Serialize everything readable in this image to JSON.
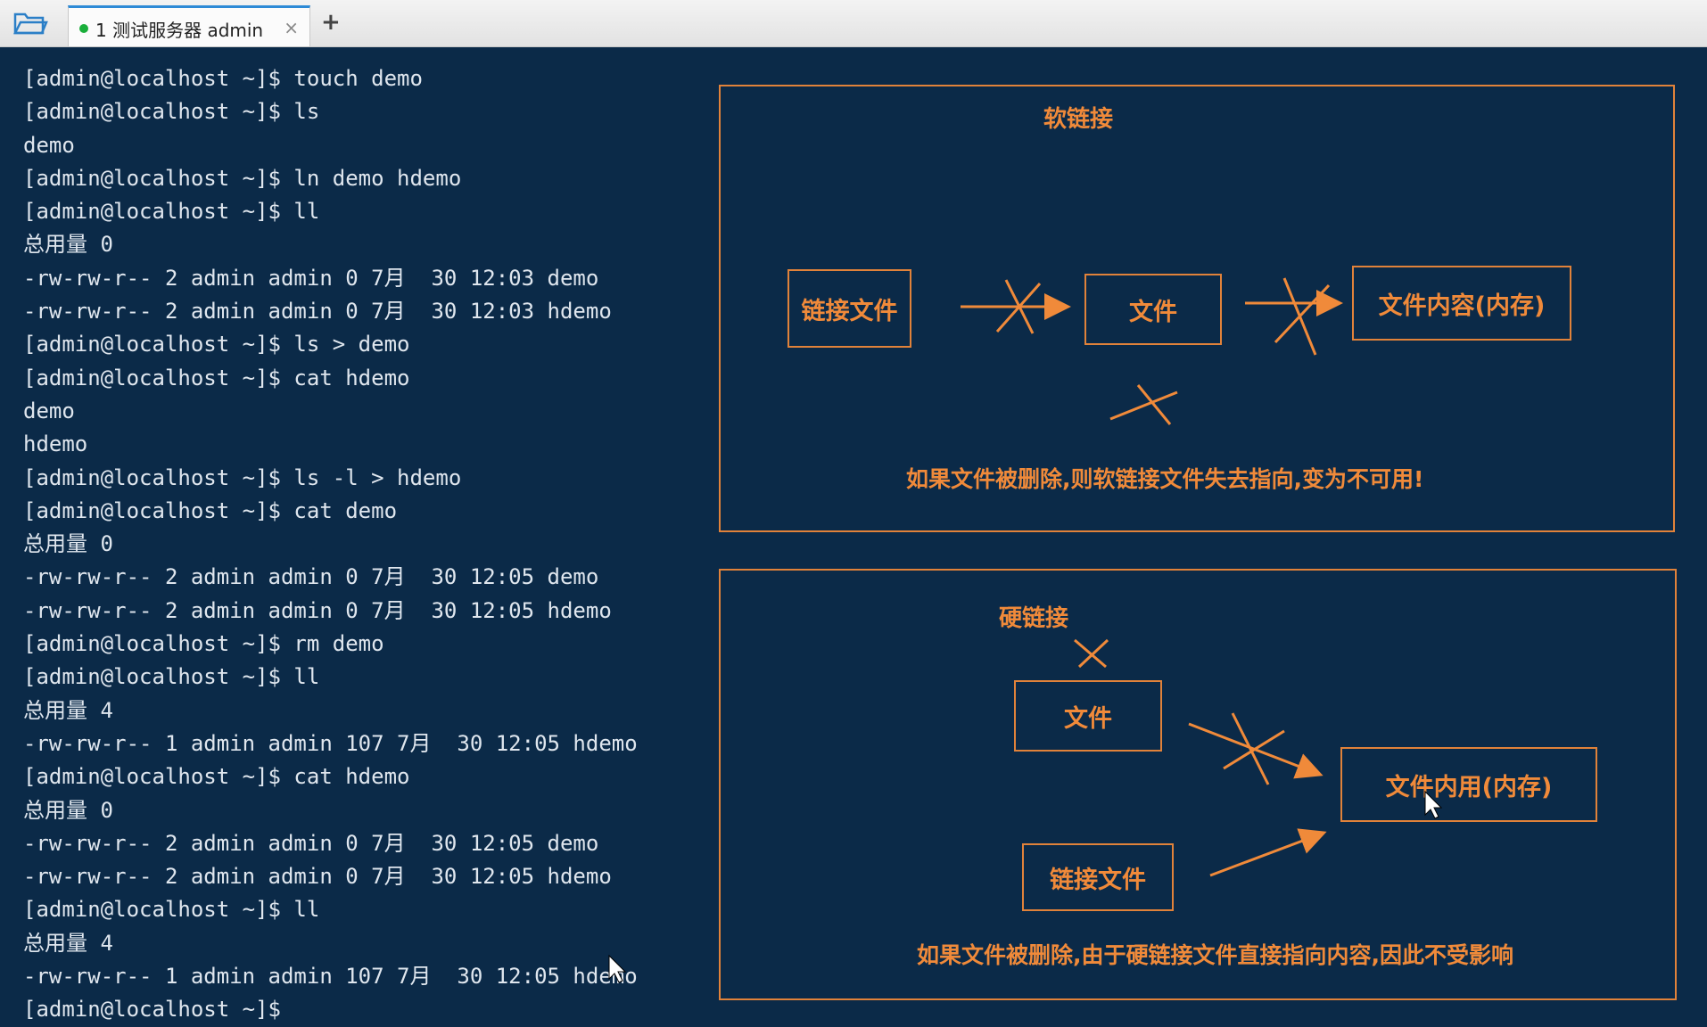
{
  "tabbar": {
    "tab_label": "1 测试服务器 admin",
    "tab_close": "×",
    "add": "+"
  },
  "terminal": {
    "lines": [
      "[admin@localhost ~]$ touch demo",
      "[admin@localhost ~]$ ls",
      "demo",
      "[admin@localhost ~]$ ln demo hdemo",
      "[admin@localhost ~]$ ll",
      "总用量 0",
      "-rw-rw-r-- 2 admin admin 0 7月  30 12:03 demo",
      "-rw-rw-r-- 2 admin admin 0 7月  30 12:03 hdemo",
      "[admin@localhost ~]$ ls > demo",
      "[admin@localhost ~]$ cat hdemo",
      "demo",
      "hdemo",
      "[admin@localhost ~]$ ls -l > hdemo",
      "[admin@localhost ~]$ cat demo",
      "总用量 0",
      "-rw-rw-r-- 2 admin admin 0 7月  30 12:05 demo",
      "-rw-rw-r-- 2 admin admin 0 7月  30 12:05 hdemo",
      "[admin@localhost ~]$ rm demo",
      "[admin@localhost ~]$ ll",
      "总用量 4",
      "-rw-rw-r-- 1 admin admin 107 7月  30 12:05 hdemo",
      "[admin@localhost ~]$ cat hdemo",
      "总用量 0",
      "-rw-rw-r-- 2 admin admin 0 7月  30 12:05 demo",
      "-rw-rw-r-- 2 admin admin 0 7月  30 12:05 hdemo",
      "[admin@localhost ~]$ ll",
      "总用量 4",
      "-rw-rw-r-- 1 admin admin 107 7月  30 12:05 hdemo",
      "[admin@localhost ~]$"
    ]
  },
  "soft_link": {
    "title": "软链接",
    "link_file": "链接文件",
    "file": "文件",
    "content": "文件内容(内存)",
    "note": "如果文件被删除,则软链接文件失去指向,变为不可用!"
  },
  "hard_link": {
    "title": "硬链接",
    "file": "文件",
    "content": "文件内用(内存)",
    "link_file": "链接文件",
    "note": "如果文件被删除,由于硬链接文件直接指向内容,因此不受影响"
  },
  "colors": {
    "terminal_bg": "#0b2a48",
    "terminal_text": "#dfe6ee",
    "annotation": "#f08a3a"
  }
}
